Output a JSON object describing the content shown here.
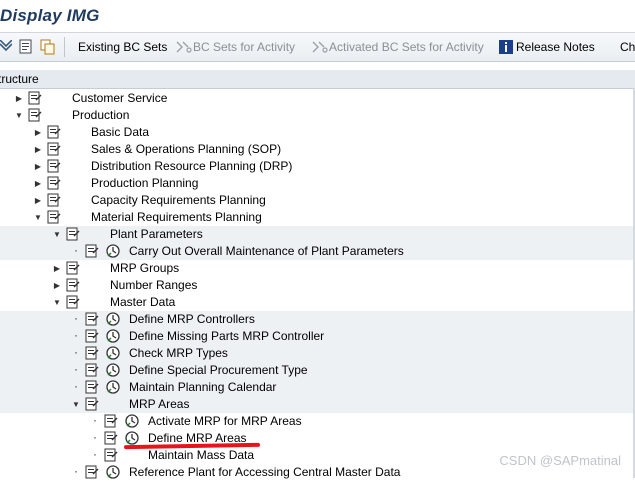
{
  "window": {
    "title": "Display IMG"
  },
  "toolbar": {
    "existing_bc_sets": "Existing BC Sets",
    "bc_sets_for_activity": "BC Sets for Activity",
    "activated_bc_sets": "Activated BC Sets for Activity",
    "release_notes": "Release Notes",
    "truncated_item": "Ch"
  },
  "header": {
    "structure_label": "tructure"
  },
  "tree": {
    "rows": [
      {
        "label": "Customer Service"
      },
      {
        "label": "Production"
      },
      {
        "label": "Basic Data"
      },
      {
        "label": "Sales & Operations Planning (SOP)"
      },
      {
        "label": "Distribution Resource Planning (DRP)"
      },
      {
        "label": "Production Planning"
      },
      {
        "label": "Capacity Requirements Planning"
      },
      {
        "label": "Material Requirements Planning"
      },
      {
        "label": "Plant Parameters"
      },
      {
        "label": "Carry Out Overall Maintenance of Plant Parameters"
      },
      {
        "label": "MRP Groups"
      },
      {
        "label": "Number Ranges"
      },
      {
        "label": "Master Data"
      },
      {
        "label": "Define MRP Controllers"
      },
      {
        "label": "Define Missing Parts MRP Controller"
      },
      {
        "label": "Check MRP Types"
      },
      {
        "label": "Define Special Procurement Type"
      },
      {
        "label": "Maintain Planning Calendar"
      },
      {
        "label": "MRP Areas"
      },
      {
        "label": "Activate MRP for MRP Areas"
      },
      {
        "label": "Define MRP Areas"
      },
      {
        "label": "Maintain Mass Data"
      },
      {
        "label": "Reference Plant for Accessing Central Master Data"
      }
    ]
  },
  "watermark": "CSDN @SAPmatinal",
  "colors": {
    "title": "#1f3a5f",
    "highlight_mark": "#e8141b"
  }
}
